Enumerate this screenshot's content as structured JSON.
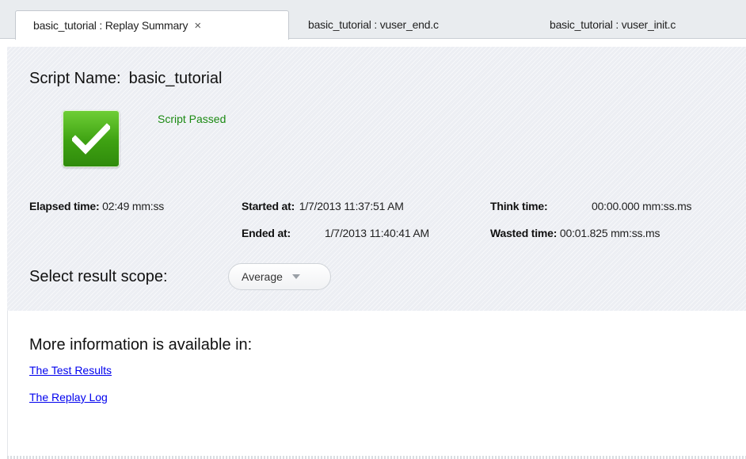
{
  "tabs": [
    {
      "label": "basic_tutorial : Replay Summary",
      "active": true,
      "close_icon": "×"
    },
    {
      "label": "basic_tutorial : vuser_end.c",
      "active": false
    },
    {
      "label": "basic_tutorial : vuser_init.c",
      "active": false
    }
  ],
  "summary": {
    "script_name_label": "Script Name:",
    "script_name": "basic_tutorial",
    "status_icon": "checkmark-icon",
    "status_text": "Script Passed",
    "status_color": "#1b8a12",
    "elapsed_label": "Elapsed time:",
    "elapsed_value": "02:49 mm:ss",
    "started_label": "Started at:",
    "started_value": "1/7/2013 11:37:51 AM",
    "ended_label": "Ended at:",
    "ended_value": "1/7/2013 11:40:41 AM",
    "think_label": "Think time:",
    "think_value": "00:00.000 mm:ss.ms",
    "wasted_label": "Wasted time:",
    "wasted_value": "00:01.825 mm:ss.ms",
    "scope_label": "Select result scope:",
    "scope_value": "Average"
  },
  "more_info": {
    "title": "More information is available in:",
    "links": [
      "The Test Results",
      "The Replay Log"
    ],
    "link_color": "#0000ee"
  }
}
